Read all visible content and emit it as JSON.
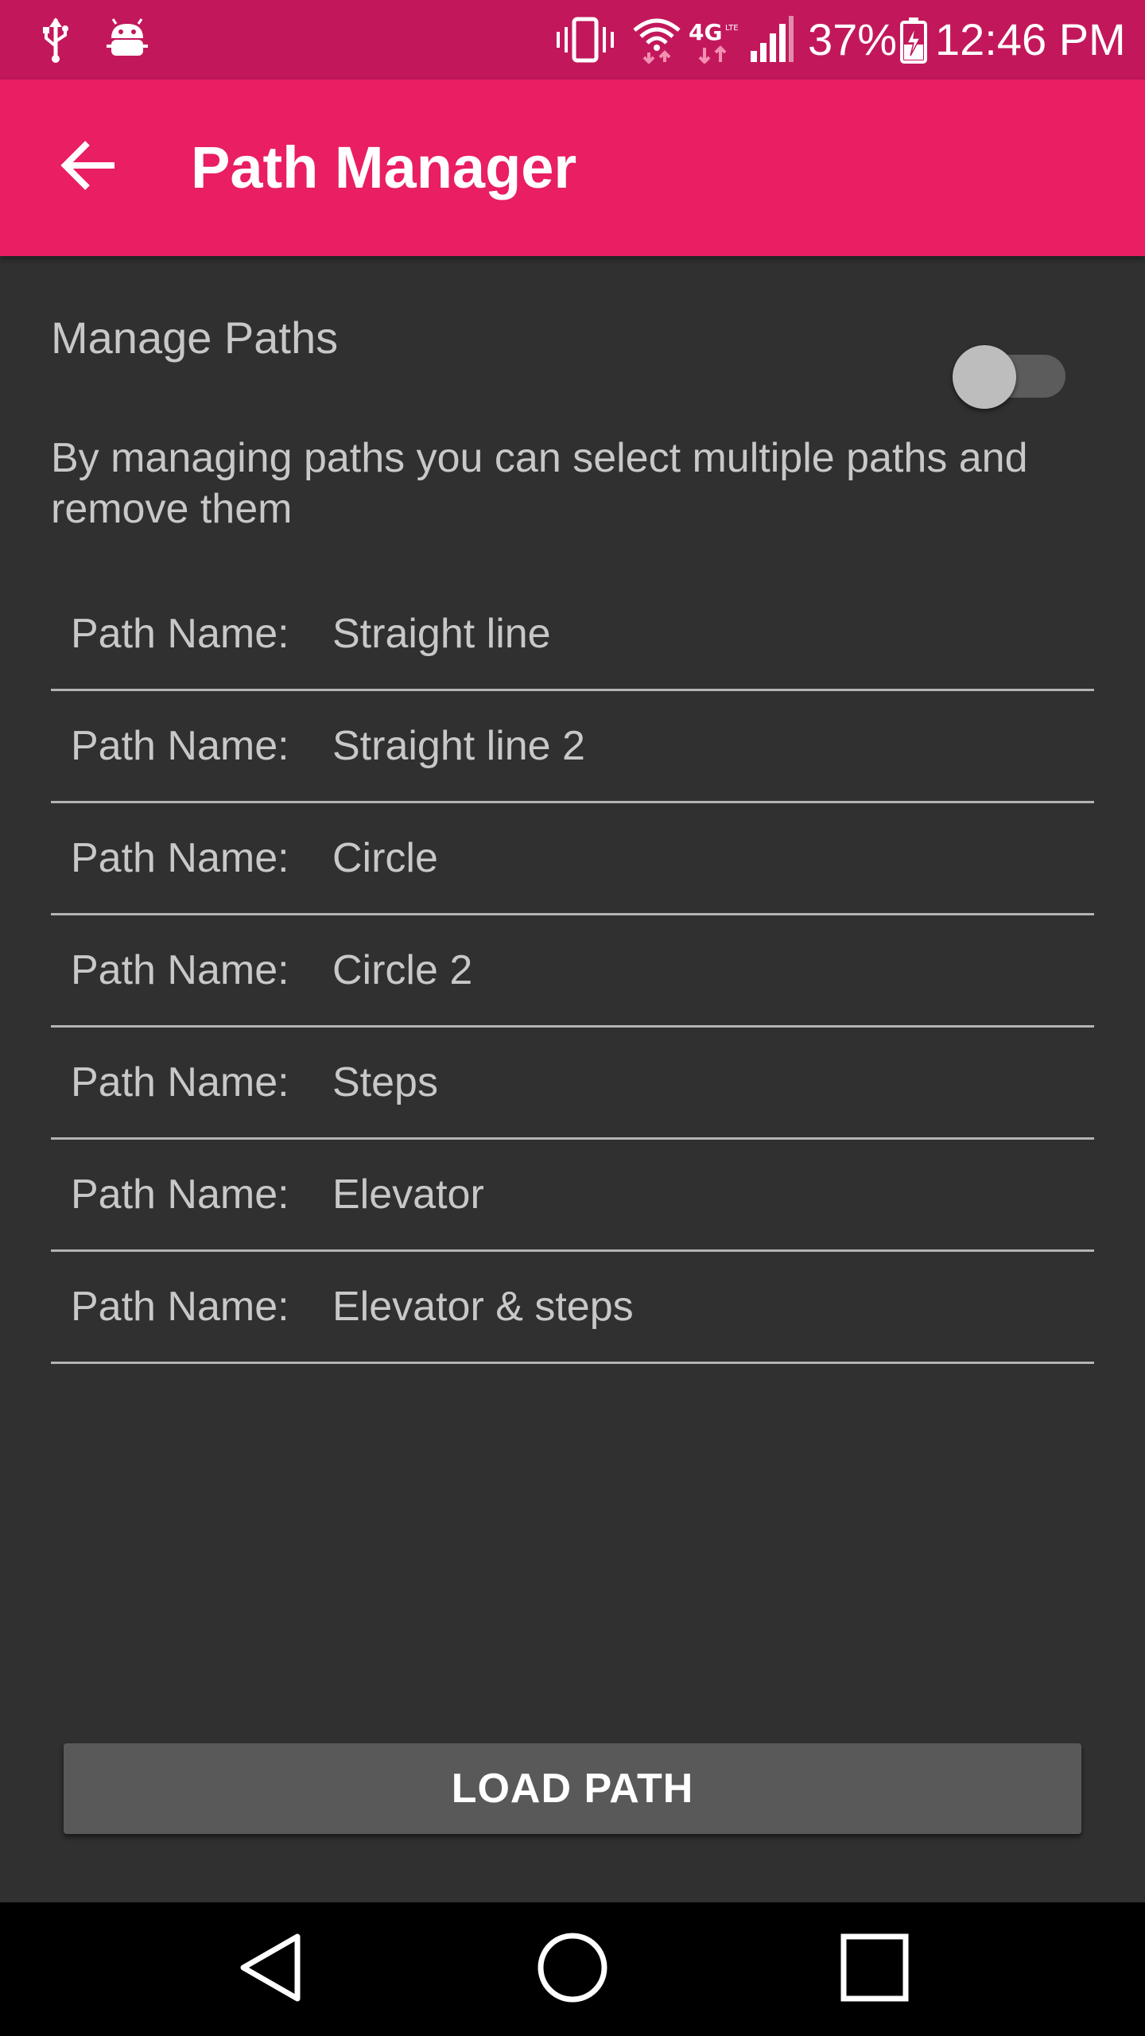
{
  "status_bar": {
    "icons": [
      "usb-icon",
      "android-debug-icon",
      "vibrate-icon",
      "wifi-icon",
      "4g-lte-icon",
      "signal-icon",
      "battery-charging-icon"
    ],
    "battery_percent": "37%",
    "time": "12:46 PM",
    "colors": {
      "background": "#c2185b"
    }
  },
  "app_bar": {
    "title": "Path Manager",
    "back_icon": "arrow-back-icon",
    "colors": {
      "background": "#e91e63"
    }
  },
  "manage": {
    "label": "Manage Paths",
    "toggle_on": false,
    "description": "By managing paths you can select multiple paths and remove them"
  },
  "paths": [
    {
      "label": "Path Name:",
      "name": "Straight line"
    },
    {
      "label": "Path Name:",
      "name": "Straight line 2"
    },
    {
      "label": "Path Name:",
      "name": "Circle"
    },
    {
      "label": "Path Name:",
      "name": "Circle 2"
    },
    {
      "label": "Path Name:",
      "name": "Steps"
    },
    {
      "label": "Path Name:",
      "name": "Elevator"
    },
    {
      "label": "Path Name:",
      "name": "Elevator & steps"
    }
  ],
  "actions": {
    "load_label": "LOAD PATH"
  },
  "nav_bar": {
    "icons": [
      "nav-back-icon",
      "nav-home-icon",
      "nav-recents-icon"
    ]
  }
}
